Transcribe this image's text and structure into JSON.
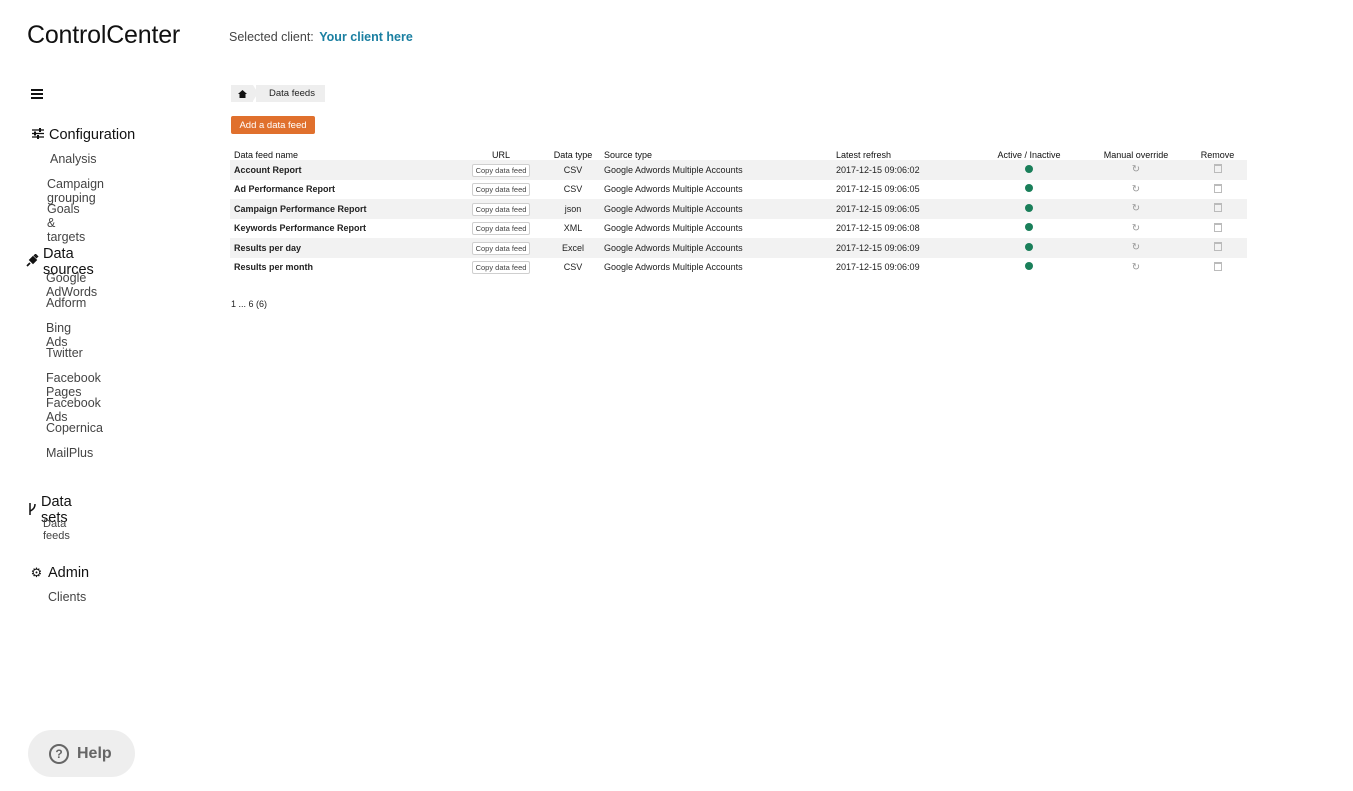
{
  "app": {
    "title": "ControlCenter"
  },
  "client": {
    "label": "Selected client:",
    "name": "Your client here"
  },
  "sidebar": {
    "configuration": {
      "label": "Configuration",
      "items": [
        "Analysis",
        "Campaign grouping",
        "Goals & targets"
      ]
    },
    "data_sources": {
      "label": "Data sources",
      "items": [
        "Google AdWords",
        "Adform",
        "Bing Ads",
        "Twitter",
        "Facebook Pages",
        "Facebook Ads",
        "Copernica",
        "MailPlus"
      ]
    },
    "data_sets": {
      "label": "Data sets",
      "items": [
        "Data feeds"
      ]
    },
    "admin": {
      "label": "Admin",
      "items": [
        "Clients"
      ]
    }
  },
  "breadcrumb": {
    "current": "Data feeds"
  },
  "add_button": "Add a data feed",
  "table": {
    "headers": [
      "Data feed name",
      "URL",
      "Data type",
      "Source type",
      "Latest refresh",
      "Active / Inactive",
      "Manual override",
      "Remove"
    ],
    "copy_label": "Copy data feed",
    "rows": [
      {
        "name": "Account Report",
        "type": "CSV",
        "source": "Google Adwords Multiple Accounts",
        "refresh": "2017-12-15 09:06:02"
      },
      {
        "name": "Ad Performance Report",
        "type": "CSV",
        "source": "Google Adwords Multiple Accounts",
        "refresh": "2017-12-15 09:06:05"
      },
      {
        "name": "Campaign Performance Report",
        "type": "json",
        "source": "Google Adwords Multiple Accounts",
        "refresh": "2017-12-15 09:06:05"
      },
      {
        "name": "Keywords Performance Report",
        "type": "XML",
        "source": "Google Adwords Multiple Accounts",
        "refresh": "2017-12-15 09:06:08"
      },
      {
        "name": "Results per day",
        "type": "Excel",
        "source": "Google Adwords Multiple Accounts",
        "refresh": "2017-12-15 09:06:09"
      },
      {
        "name": "Results per month",
        "type": "CSV",
        "source": "Google Adwords Multiple Accounts",
        "refresh": "2017-12-15 09:06:09"
      }
    ]
  },
  "pagination": "1 ... 6 (6)",
  "help": {
    "label": "Help"
  },
  "colors": {
    "accent": "#1a7fa1",
    "button": "#e0702d",
    "active": "#1a7f5a"
  }
}
